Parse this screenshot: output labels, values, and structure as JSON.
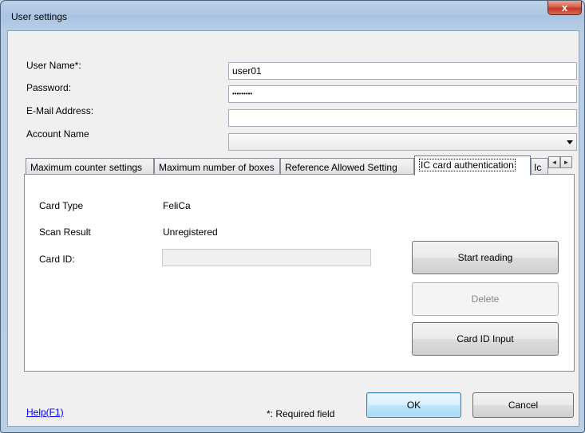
{
  "window": {
    "title": "User settings",
    "close_glyph": "x"
  },
  "form": {
    "user_name_label": "User Name*:",
    "user_name_value": "user01",
    "password_label": "Password:",
    "password_value": "•••••••••",
    "email_label": "E-Mail Address:",
    "email_value": "",
    "account_label": "Account Name",
    "account_value": ""
  },
  "tabs": [
    {
      "label": "Maximum counter settings"
    },
    {
      "label": "Maximum number of boxes"
    },
    {
      "label": "Reference Allowed Setting"
    },
    {
      "label": "IC card authentication",
      "active": true
    },
    {
      "label": "Ic"
    }
  ],
  "ic_card": {
    "card_type_label": "Card Type",
    "card_type_value": "FeliCa",
    "scan_result_label": "Scan Result",
    "scan_result_value": "Unregistered",
    "card_id_label": "Card ID:",
    "card_id_value": "",
    "start_reading_label": "Start reading",
    "delete_label": "Delete",
    "card_id_input_label": "Card ID Input"
  },
  "footer": {
    "help_label": "Help(F1)",
    "required_note": "*: Required field",
    "ok_label": "OK",
    "cancel_label": "Cancel"
  },
  "icons": {
    "tab_scroll_left": "◄",
    "tab_scroll_right": "►",
    "combo_arrow": "chevron-down-icon"
  }
}
